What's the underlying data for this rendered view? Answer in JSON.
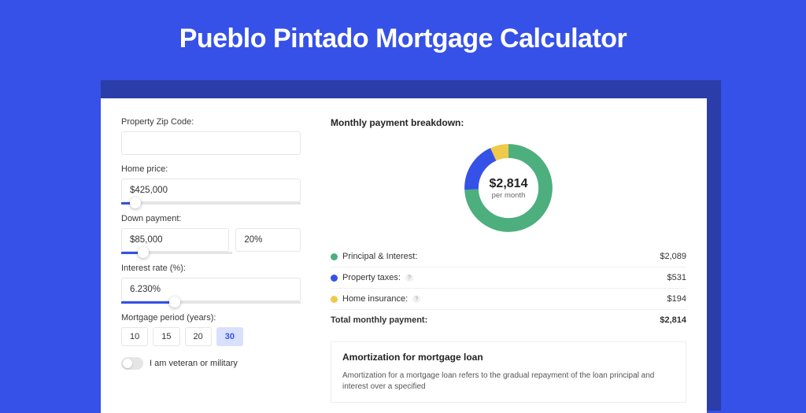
{
  "title": "Pueblo Pintado Mortgage Calculator",
  "colors": {
    "principal": "#4caf7d",
    "taxes": "#3651e8",
    "insurance": "#f0c94a"
  },
  "form": {
    "zip_label": "Property Zip Code:",
    "zip_value": "",
    "home_price_label": "Home price:",
    "home_price_value": "$425,000",
    "home_price_slider_pct": 8,
    "down_payment_label": "Down payment:",
    "down_payment_value": "$85,000",
    "down_payment_pct_value": "20%",
    "down_payment_slider_pct": 20,
    "interest_label": "Interest rate (%):",
    "interest_value": "6.230%",
    "interest_slider_pct": 30,
    "period_label": "Mortgage period (years):",
    "periods": [
      "10",
      "15",
      "20",
      "30"
    ],
    "period_active_index": 3,
    "veteran_label": "I am veteran or military"
  },
  "breakdown": {
    "title": "Monthly payment breakdown:",
    "center_amount": "$2,814",
    "center_sub": "per month",
    "rows": [
      {
        "label": "Principal & Interest:",
        "value": "$2,089",
        "colorKey": "principal",
        "info": false
      },
      {
        "label": "Property taxes:",
        "value": "$531",
        "colorKey": "taxes",
        "info": true
      },
      {
        "label": "Home insurance:",
        "value": "$194",
        "colorKey": "insurance",
        "info": true
      }
    ],
    "total_label": "Total monthly payment:",
    "total_value": "$2,814"
  },
  "chart_data": {
    "type": "pie",
    "title": "Monthly payment breakdown",
    "series": [
      {
        "name": "Principal & Interest",
        "value": 2089
      },
      {
        "name": "Property taxes",
        "value": 531
      },
      {
        "name": "Home insurance",
        "value": 194
      }
    ],
    "total": 2814,
    "unit": "USD per month"
  },
  "amortization": {
    "title": "Amortization for mortgage loan",
    "text": "Amortization for a mortgage loan refers to the gradual repayment of the loan principal and interest over a specified"
  }
}
